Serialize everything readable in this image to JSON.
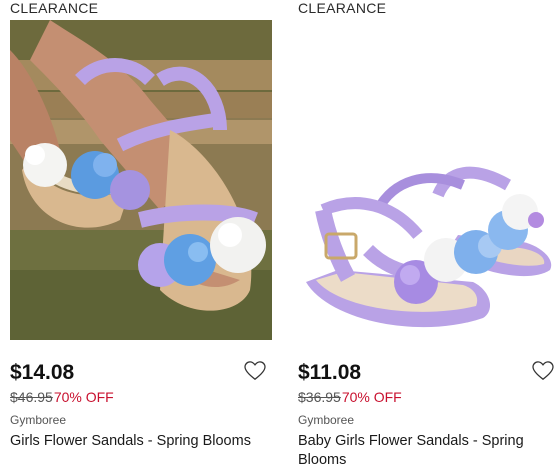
{
  "products": [
    {
      "badge": "CLEARANCE",
      "price": "$14.08",
      "original_price": "$46.95",
      "discount": "70% OFF",
      "brand": "Gymboree",
      "name": "Girls Flower Sandals - Spring Blooms",
      "image": "girl-wearing-purple-flower-sandals-photo"
    },
    {
      "badge": "CLEARANCE",
      "price": "$11.08",
      "original_price": "$36.95",
      "discount": "70% OFF",
      "brand": "Gymboree",
      "name": "Baby Girls Flower Sandals - Spring Blooms",
      "image": "purple-baby-flower-sandals-photo"
    }
  ],
  "icons": {
    "wishlist": "heart-outline-icon"
  },
  "colors": {
    "discount": "#c8102e",
    "sandal_purple": "#b9a2e6"
  }
}
